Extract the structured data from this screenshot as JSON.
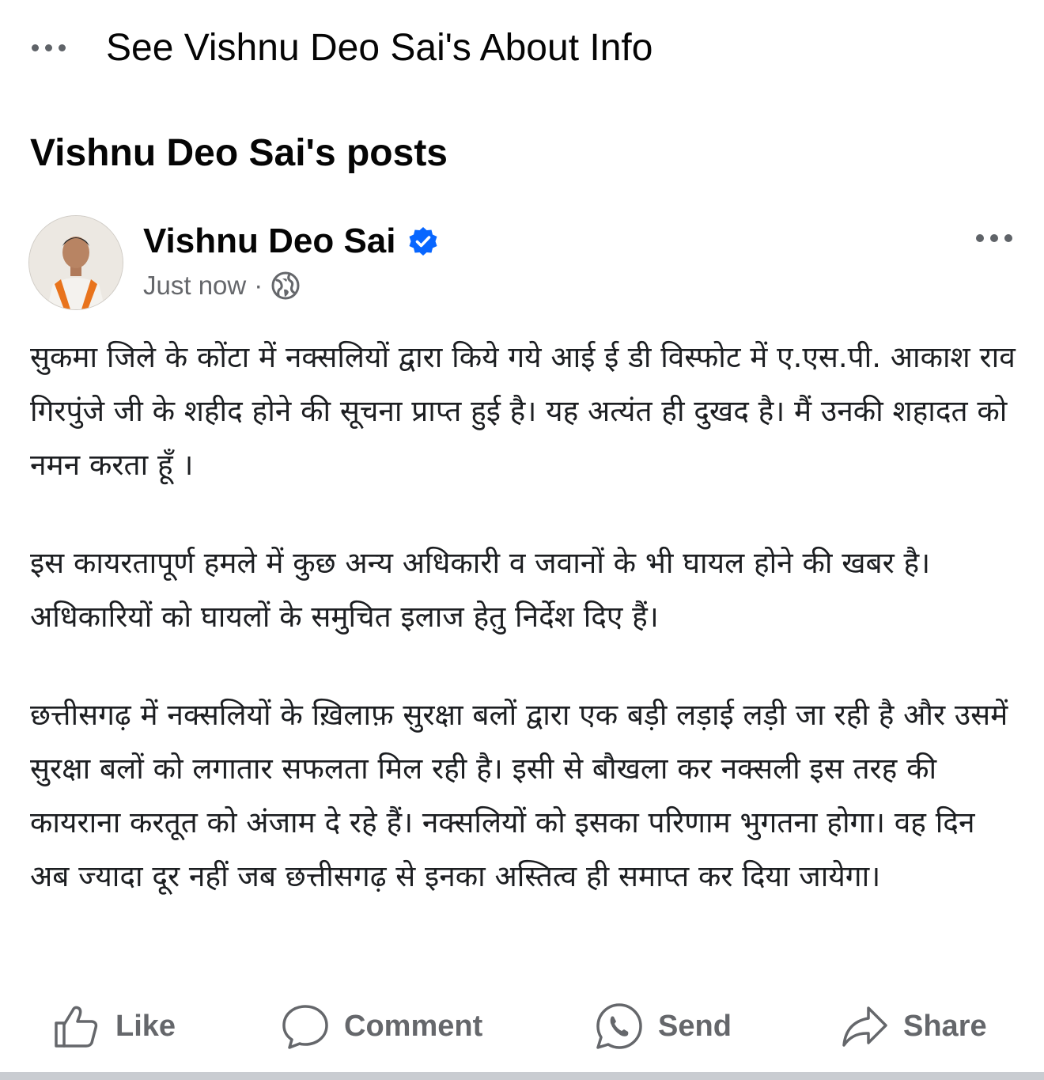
{
  "about": {
    "label": "See Vishnu Deo Sai's About Info",
    "icon": "more-horizontal-icon"
  },
  "section": {
    "title": "Vishnu Deo Sai's posts"
  },
  "post": {
    "author": "Vishnu Deo Sai",
    "verified": true,
    "timestamp": "Just now",
    "separator": "·",
    "audience_icon": "globe-icon",
    "paragraphs": [
      "सुकमा जिले के कोंटा में नक्सलियों द्वारा किये गये आई ई डी विस्फोट में ए.एस.पी. आकाश राव गिरपुंजे जी के शहीद होने की सूचना प्राप्त हुई है। यह अत्यंत ही दुखद है। मैं उनकी शहादत को नमन करता हूँ ।",
      "इस कायरतापूर्ण हमले में कुछ अन्य अधिकारी व जवानों के भी घायल होने की खबर है। अधिकारियों को घायलों के समुचित इलाज हेतु निर्देश दिए हैं।",
      "छत्तीसगढ़ में नक्सलियों के ख़िलाफ़ सुरक्षा बलों द्वारा एक बड़ी लड़ाई लड़ी जा रही है और उसमें सुरक्षा बलों को लगातार सफलता मिल रही है। इसी से बौखला कर नक्सली इस तरह की कायराना करतूत को अंजाम दे रहे हैं। नक्सलियों को इसका परिणाम भुगतना होगा। वह दिन अब ज्यादा दूर नहीं जब छत्तीसगढ़ से इनका अस्तित्व ही समाप्त कर दिया जायेगा।"
    ]
  },
  "actions": {
    "like": "Like",
    "comment": "Comment",
    "send": "Send",
    "share": "Share"
  },
  "colors": {
    "text_primary": "#050505",
    "text_secondary": "#65676b",
    "verified_blue": "#0866ff"
  }
}
